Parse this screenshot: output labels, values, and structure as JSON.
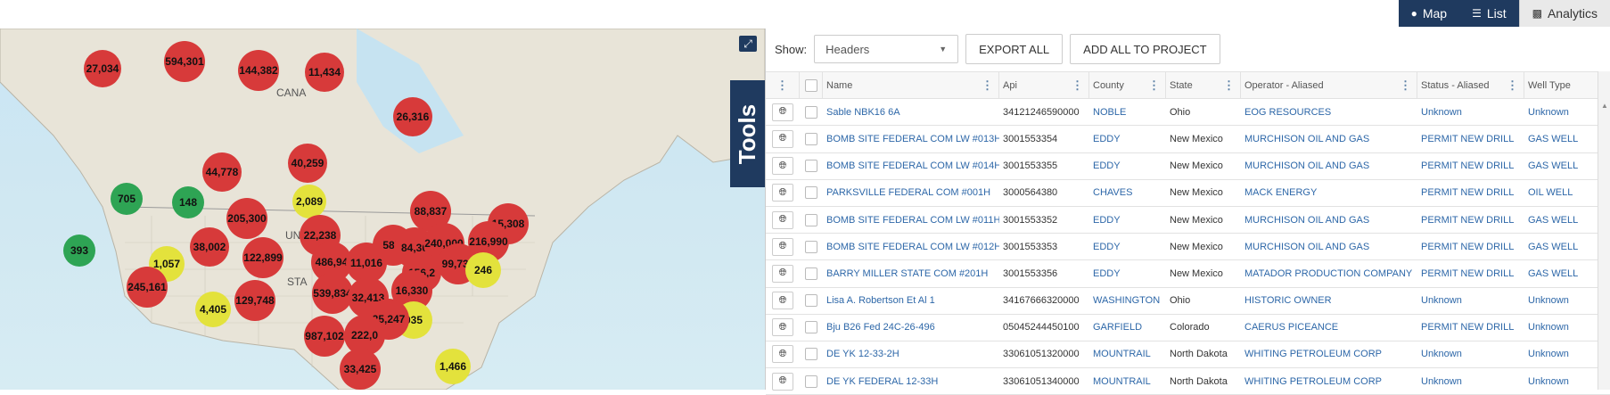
{
  "view_tabs": [
    {
      "label": "Map",
      "icon": "globe-icon",
      "active": false
    },
    {
      "label": "List",
      "icon": "list-icon",
      "active": false
    },
    {
      "label": "Analytics",
      "icon": "bar-chart-icon",
      "active": true
    }
  ],
  "map": {
    "country_labels": [
      "CANA",
      "UN",
      "STA"
    ],
    "tools_label": "Tools",
    "colors": {
      "red": "#d73a3a",
      "yellow": "#e3e23c",
      "green": "#2ea454"
    },
    "clusters": [
      {
        "label": "27,034",
        "color": "red"
      },
      {
        "label": "594,301",
        "color": "red"
      },
      {
        "label": "144,382",
        "color": "red"
      },
      {
        "label": "11,434",
        "color": "red"
      },
      {
        "label": "26,316",
        "color": "red"
      },
      {
        "label": "44,778",
        "color": "red"
      },
      {
        "label": "40,259",
        "color": "red"
      },
      {
        "label": "705",
        "color": "green"
      },
      {
        "label": "148",
        "color": "green"
      },
      {
        "label": "2,089",
        "color": "yellow"
      },
      {
        "label": "205,300",
        "color": "red"
      },
      {
        "label": "88,837",
        "color": "red"
      },
      {
        "label": "15,308",
        "color": "red"
      },
      {
        "label": "393",
        "color": "green"
      },
      {
        "label": "38,002",
        "color": "red"
      },
      {
        "label": "22,238",
        "color": "red"
      },
      {
        "label": "587,",
        "color": "red"
      },
      {
        "label": "84,36",
        "color": "red"
      },
      {
        "label": "240,000",
        "color": "red"
      },
      {
        "label": "216,990",
        "color": "red"
      },
      {
        "label": "1,057",
        "color": "yellow"
      },
      {
        "label": "122,899",
        "color": "red"
      },
      {
        "label": "486,94",
        "color": "red"
      },
      {
        "label": "11,016",
        "color": "red"
      },
      {
        "label": "99,730",
        "color": "red"
      },
      {
        "label": "246",
        "color": "yellow"
      },
      {
        "label": "245,161",
        "color": "red"
      },
      {
        "label": "156,2",
        "color": "red"
      },
      {
        "label": "16,330",
        "color": "red"
      },
      {
        "label": "539,834",
        "color": "red"
      },
      {
        "label": "32,413",
        "color": "red"
      },
      {
        "label": "4,405",
        "color": "yellow"
      },
      {
        "label": "129,748",
        "color": "red"
      },
      {
        "label": "035",
        "color": "yellow"
      },
      {
        "label": "25,247",
        "color": "red"
      },
      {
        "label": "987,102",
        "color": "red"
      },
      {
        "label": "222,0",
        "color": "red"
      },
      {
        "label": "1,466",
        "color": "yellow"
      },
      {
        "label": "33,425",
        "color": "red"
      }
    ]
  },
  "toolbar": {
    "show_label": "Show:",
    "select_value": "Headers",
    "export_label": "EXPORT ALL",
    "add_label": "ADD ALL TO PROJECT"
  },
  "table": {
    "headers": [
      "Name",
      "Api",
      "County",
      "State",
      "Operator - Aliased",
      "Status - Aliased",
      "Well Type"
    ],
    "rows": [
      [
        "Sable NBK16 6A",
        "34121246590000",
        "NOBLE",
        "Ohio",
        "EOG RESOURCES",
        "Unknown",
        "Unknown"
      ],
      [
        "BOMB SITE FEDERAL COM LW #013H",
        "3001553354",
        "EDDY",
        "New Mexico",
        "MURCHISON OIL AND GAS",
        "PERMIT NEW DRILL",
        "GAS WELL"
      ],
      [
        "BOMB SITE FEDERAL COM LW #014H",
        "3001553355",
        "EDDY",
        "New Mexico",
        "MURCHISON OIL AND GAS",
        "PERMIT NEW DRILL",
        "GAS WELL"
      ],
      [
        "PARKSVILLE FEDERAL COM #001H",
        "3000564380",
        "CHAVES",
        "New Mexico",
        "MACK ENERGY",
        "PERMIT NEW DRILL",
        "OIL WELL"
      ],
      [
        "BOMB SITE FEDERAL COM LW #011H",
        "3001553352",
        "EDDY",
        "New Mexico",
        "MURCHISON OIL AND GAS",
        "PERMIT NEW DRILL",
        "GAS WELL"
      ],
      [
        "BOMB SITE FEDERAL COM LW #012H",
        "3001553353",
        "EDDY",
        "New Mexico",
        "MURCHISON OIL AND GAS",
        "PERMIT NEW DRILL",
        "GAS WELL"
      ],
      [
        "BARRY MILLER STATE COM #201H",
        "3001553356",
        "EDDY",
        "New Mexico",
        "MATADOR PRODUCTION COMPANY",
        "PERMIT NEW DRILL",
        "GAS WELL"
      ],
      [
        "Lisa A. Robertson Et Al 1",
        "34167666320000",
        "WASHINGTON",
        "Ohio",
        "HISTORIC OWNER",
        "Unknown",
        "Unknown"
      ],
      [
        "Bju B26 Fed 24C-26-496",
        "05045244450100",
        "GARFIELD",
        "Colorado",
        "CAERUS PICEANCE",
        "PERMIT NEW DRILL",
        "Unknown"
      ],
      [
        "DE YK 12-33-2H",
        "33061051320000",
        "MOUNTRAIL",
        "North Dakota",
        "WHITING PETROLEUM CORP",
        "Unknown",
        "Unknown"
      ],
      [
        "DE YK FEDERAL 12-33H",
        "33061051340000",
        "MOUNTRAIL",
        "North Dakota",
        "WHITING PETROLEUM CORP",
        "Unknown",
        "Unknown"
      ]
    ]
  }
}
